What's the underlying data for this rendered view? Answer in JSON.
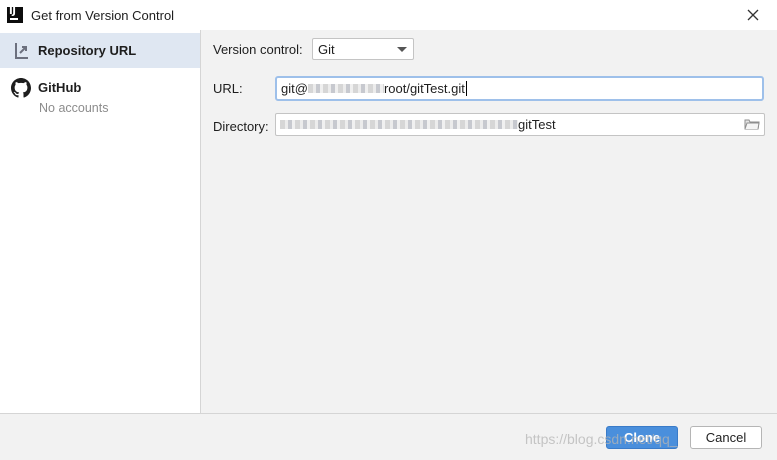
{
  "window": {
    "title": "Get from Version Control"
  },
  "sidebar": {
    "items": [
      {
        "label": "Repository URL",
        "selected": true
      },
      {
        "label": "GitHub",
        "sublabel": "No accounts",
        "selected": false
      }
    ]
  },
  "form": {
    "version_control": {
      "label": "Version control:",
      "value": "Git"
    },
    "url": {
      "label": "URL:",
      "value_prefix": "git@",
      "value_suffix": "root/gitTest.git"
    },
    "directory": {
      "label": "Directory:",
      "value_suffix": "gitTest"
    }
  },
  "buttons": {
    "clone": "Clone",
    "cancel": "Cancel"
  },
  "watermark": "https://blog.csdn.net/qq_",
  "colors": {
    "accent": "#4a8fdc",
    "selected_bg": "#dfe7f2",
    "focus_border": "#9ec0ea"
  }
}
